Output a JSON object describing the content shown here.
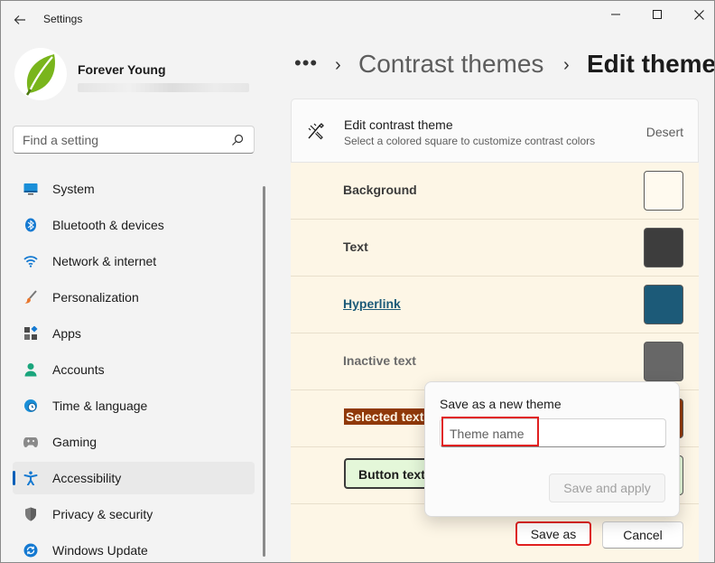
{
  "window": {
    "title": "Settings",
    "back_icon": "back-arrow-icon",
    "controls": [
      "minimize-icon",
      "maximize-icon",
      "close-icon"
    ]
  },
  "user": {
    "name": "Forever Young",
    "avatar_icon": "leaf-icon"
  },
  "search": {
    "placeholder": "Find a setting",
    "icon": "search-icon"
  },
  "sidebar": {
    "items": [
      {
        "label": "System",
        "icon": "system-icon",
        "active": false
      },
      {
        "label": "Bluetooth & devices",
        "icon": "bluetooth-icon",
        "active": false
      },
      {
        "label": "Network & internet",
        "icon": "wifi-icon",
        "active": false
      },
      {
        "label": "Personalization",
        "icon": "brush-icon",
        "active": false
      },
      {
        "label": "Apps",
        "icon": "apps-icon",
        "active": false
      },
      {
        "label": "Accounts",
        "icon": "person-icon",
        "active": false
      },
      {
        "label": "Time & language",
        "icon": "clock-globe-icon",
        "active": false
      },
      {
        "label": "Gaming",
        "icon": "gamepad-icon",
        "active": false
      },
      {
        "label": "Accessibility",
        "icon": "accessibility-icon",
        "active": true
      },
      {
        "label": "Privacy & security",
        "icon": "shield-icon",
        "active": false
      },
      {
        "label": "Windows Update",
        "icon": "update-icon",
        "active": false
      }
    ]
  },
  "breadcrumb": {
    "overflow": "•••",
    "separator": "›",
    "items": [
      "Contrast themes",
      "Edit theme"
    ]
  },
  "editor": {
    "title": "Edit contrast theme",
    "subtitle": "Select a colored square to customize contrast colors",
    "theme_name": "Desert",
    "rows": [
      {
        "label": "Background",
        "color": "#fffaef"
      },
      {
        "label": "Text",
        "color": "#3d3d3d"
      },
      {
        "label": "Hyperlink",
        "color": "#1c5a78"
      },
      {
        "label": "Inactive text",
        "color": "#676767"
      },
      {
        "label": "Selected text",
        "color": "#903909"
      },
      {
        "label": "Button text",
        "color": "#e4f7d9"
      }
    ],
    "save_as_label": "Save as",
    "cancel_label": "Cancel"
  },
  "flyout": {
    "title": "Save as a new theme",
    "input_placeholder": "Theme name",
    "input_value": "",
    "apply_label": "Save and apply"
  },
  "colors": {
    "accent": "#005fb8",
    "highlight_box": "#e02020",
    "row_background": "#fdf6e6"
  }
}
